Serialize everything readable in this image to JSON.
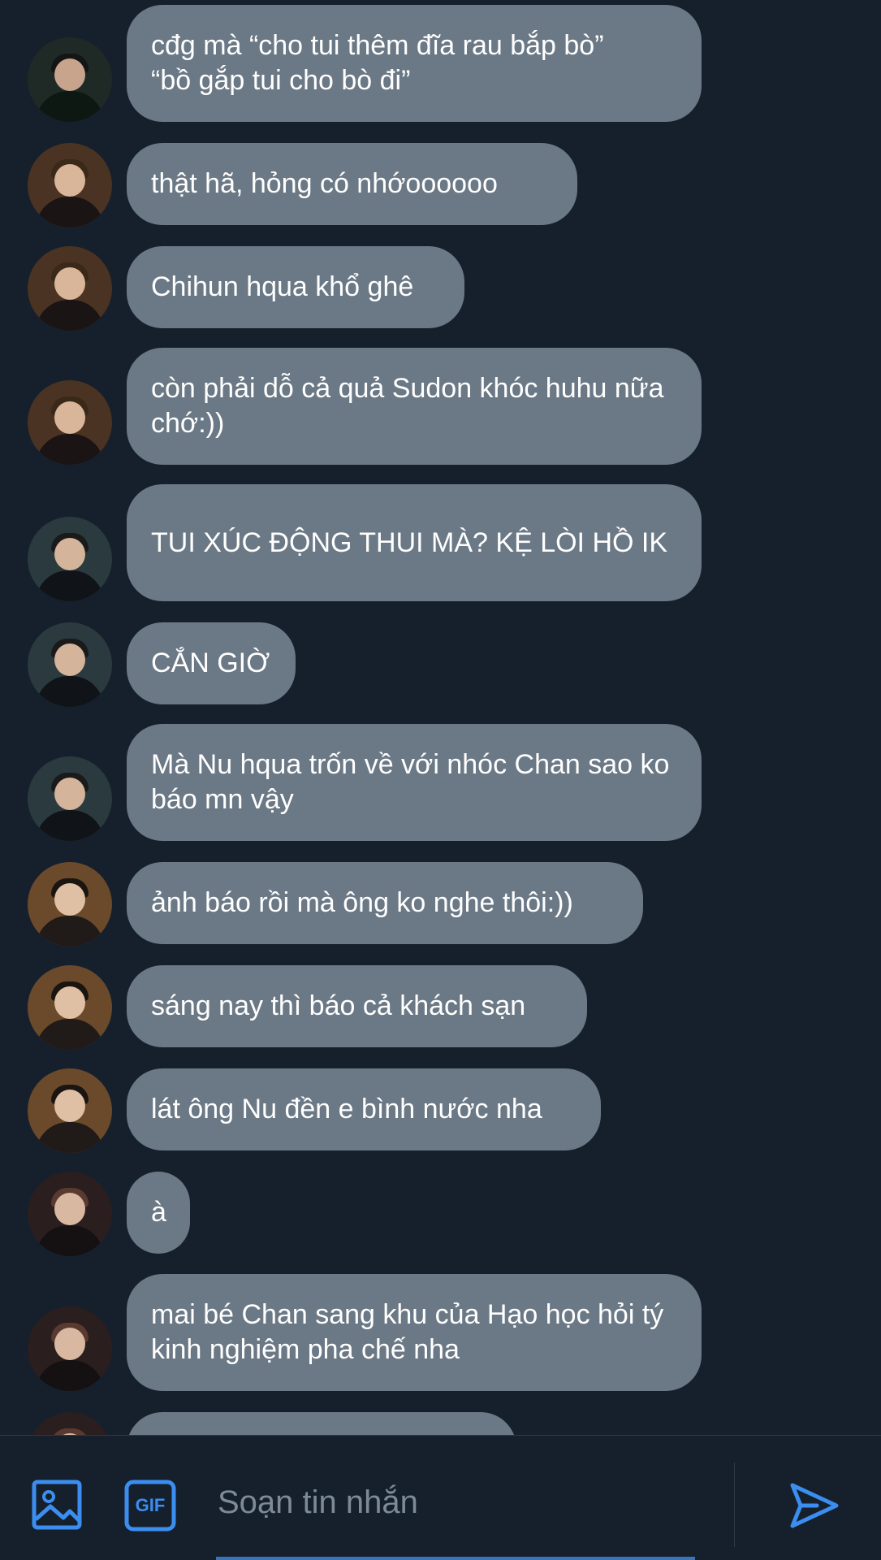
{
  "messages": [
    {
      "text": "cđg mà “cho tui thêm đĩa rau bắp bò”\n“bồ gắp tui cho bò đi”",
      "avatar": "avatar-a"
    },
    {
      "text": "thật hã, hỏng có nhớoooooo",
      "avatar": "avatar-b"
    },
    {
      "text": "Chihun hqua khổ ghê",
      "avatar": "avatar-b"
    },
    {
      "text": "còn phải dỗ cả quả Sudon khóc huhu nữa chớ:))",
      "avatar": "avatar-b"
    },
    {
      "text": "TUI XÚC ĐỘNG THUI MÀ? KỆ LÒI HỒ IK",
      "avatar": "avatar-c"
    },
    {
      "text": "CẮN GIỜ",
      "avatar": "avatar-c"
    },
    {
      "text": "Mà Nu hqua trốn về với nhóc Chan sao ko báo mn vậy",
      "avatar": "avatar-c"
    },
    {
      "text": "ảnh báo rồi mà ông ko nghe thôi:))",
      "avatar": "avatar-d"
    },
    {
      "text": "sáng nay thì báo cả khách sạn",
      "avatar": "avatar-d"
    },
    {
      "text": "lát ông Nu đền e bình nước nha",
      "avatar": "avatar-d"
    },
    {
      "text": "à",
      "avatar": "avatar-e"
    },
    {
      "text": "mai bé Chan sang khu của Hạo học hỏi tý kinh nghiệm pha chế nha",
      "avatar": "avatar-e"
    },
    {
      "text": "",
      "avatar": "avatar-e"
    }
  ],
  "composer": {
    "placeholder": "Soạn tin nhắn",
    "gif_label": "GIF",
    "image_icon": "image-icon",
    "gif_icon": "gif-icon",
    "send_icon": "send-icon"
  },
  "colors": {
    "background": "#16202c",
    "bubble": "#6b7885",
    "accent": "#3b8ef0"
  }
}
